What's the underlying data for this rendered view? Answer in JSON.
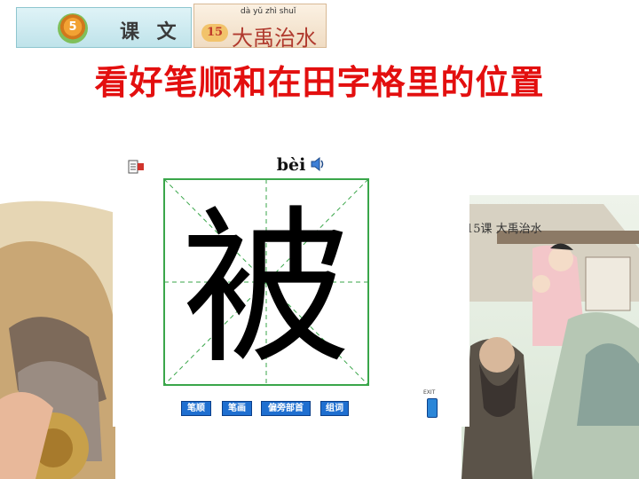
{
  "header": {
    "lesson_badge": "5",
    "lesson_label": "课 文",
    "title_pinyin": "dà  yǔ  zhì  shuǐ",
    "title_number": "15",
    "title_text": "大禹治水"
  },
  "headline": "看好笔顺和在田字格里的位置",
  "writer": {
    "pinyin": "bèi",
    "character": "被",
    "buttons": [
      "笔顺",
      "笔画",
      "偏旁部首",
      "组词"
    ],
    "exit_label": "EXIT"
  },
  "background": {
    "lesson_caption": "15课 大禹治水"
  },
  "colors": {
    "headline": "#e30f0f",
    "grid": "#3aa64a",
    "button": "#1f6fd0"
  }
}
